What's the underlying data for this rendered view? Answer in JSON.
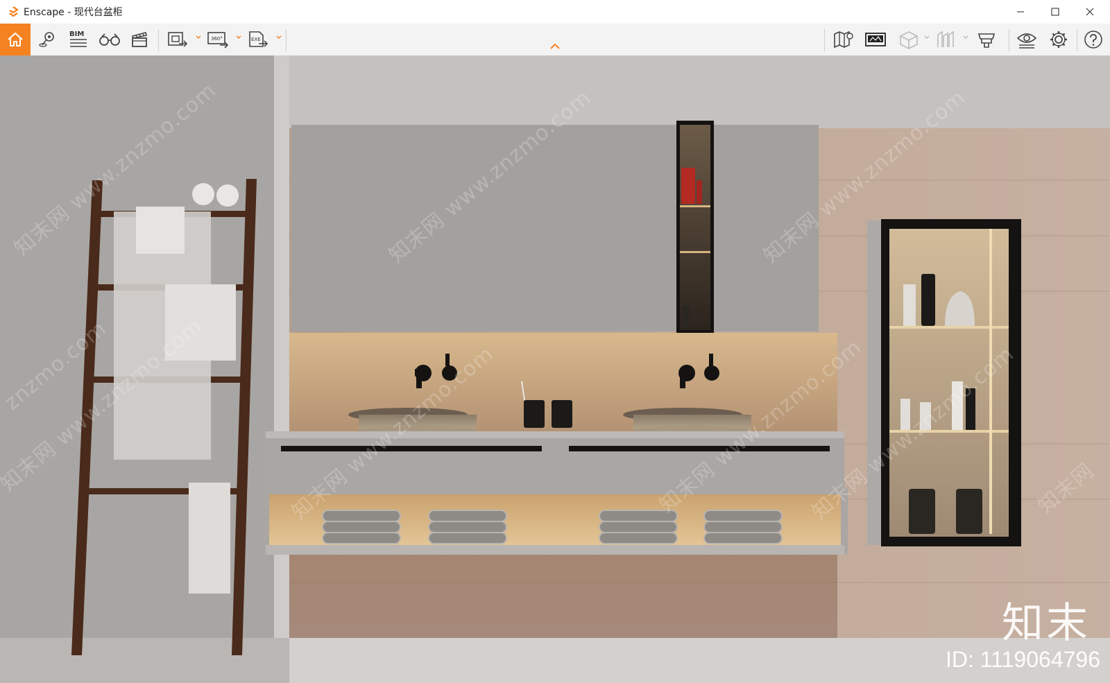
{
  "window": {
    "title": "Enscape - 现代台盆柜",
    "controls": [
      "minimize-icon",
      "maximize-icon",
      "close-icon"
    ]
  },
  "toolbar": {
    "accent": "#f58220",
    "bim_label": "BIM",
    "pano_label": "360°",
    "exe_label": "EXE",
    "left_tools": [
      "home-icon",
      "location-pin-icon",
      "bim-list-icon",
      "binoculars-icon",
      "clapper-icon",
      "screenshot-export-icon",
      "panorama-export-icon",
      "exe-export-icon"
    ],
    "right_tools": [
      "map-icon",
      "panorama-gallery-icon",
      "section-box-icon",
      "asset-library-icon",
      "material-editor-icon",
      "visual-settings-icon",
      "settings-gear-icon",
      "help-icon"
    ]
  },
  "viewport": {
    "watermarks": [
      "知末网 www.znzmo.com",
      "知末网 www.znzmo.com",
      "知末网 www.znzmo.com",
      "知末网 www.znzmo.com",
      "知末网 www.znzmo.com",
      "知末网 www.znzmo.com",
      "知末网 www.znzmo.com",
      "知末网",
      "znzmo.com"
    ],
    "brand": "知末",
    "id_text": "ID: 1119064796"
  }
}
